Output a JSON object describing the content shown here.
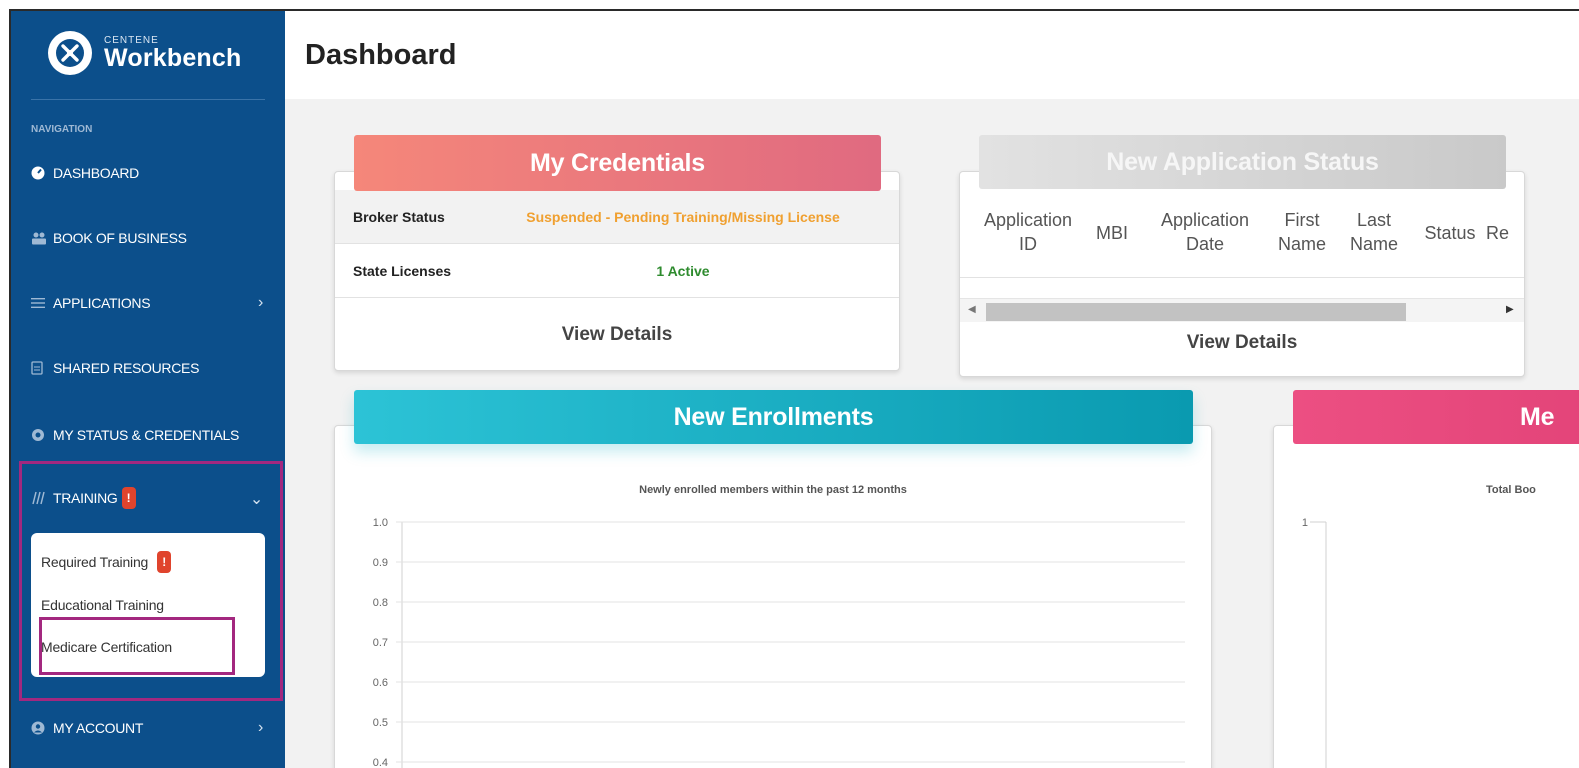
{
  "app": {
    "brand_small": "CENTENE",
    "brand_big": "Workbench"
  },
  "sidebar": {
    "heading": "NAVIGATION",
    "items": [
      {
        "label": "DASHBOARD",
        "icon": "dashboard-gauge-icon"
      },
      {
        "label": "BOOK OF BUSINESS",
        "icon": "people-icon"
      },
      {
        "label": "APPLICATIONS",
        "icon": "list-icon",
        "has_chevron": true
      },
      {
        "label": "SHARED RESOURCES",
        "icon": "document-icon"
      },
      {
        "label": "MY STATUS & CREDENTIALS",
        "icon": "gear-badge-icon"
      },
      {
        "label": "TRAINING",
        "icon": "books-icon",
        "badge": "!",
        "expanded": true
      },
      {
        "label": "MY ACCOUNT",
        "icon": "user-circle-icon",
        "has_chevron": true
      }
    ],
    "training_submenu": [
      {
        "label": "Required Training",
        "badge": "!"
      },
      {
        "label": "Educational Training"
      },
      {
        "label": "Medicare Certification",
        "highlighted": true
      }
    ],
    "chevron_right": "›",
    "chevron_down": "⌄"
  },
  "header": {
    "title": "Dashboard"
  },
  "credentials_card": {
    "title": "My Credentials",
    "rows": [
      {
        "label": "Broker Status",
        "value": "Suspended - Pending Training/Missing License",
        "color": "#f0a030"
      },
      {
        "label": "State Licenses",
        "value": "1 Active",
        "color": "#2e8b2e"
      }
    ],
    "view_details": "View Details"
  },
  "application_status_card": {
    "title": "New Application Status",
    "columns": [
      [
        "Application",
        "ID"
      ],
      [
        "MBI"
      ],
      [
        "Application",
        "Date"
      ],
      [
        "First",
        "Name"
      ],
      [
        "Last",
        "Name"
      ],
      [
        "Status"
      ],
      [
        "Re"
      ]
    ],
    "view_details": "View Details"
  },
  "enrollments_card": {
    "title": "New Enrollments"
  },
  "members_card": {
    "title": "Me"
  },
  "colors": {
    "sidebar_bg": "#0c4f8b",
    "highlight_border": "#a3287f",
    "credentials_header": "#f0837a",
    "status_header": "#cfcfcf",
    "enrollments_header": "#22bcd0",
    "members_header": "#e64a7c",
    "alert_badge": "#e0442d"
  },
  "chart_data": [
    {
      "type": "line",
      "title": "Newly enrolled members within the past 12 months",
      "y_ticks": [
        "1.0",
        "0.9",
        "0.8",
        "0.7",
        "0.6",
        "0.5",
        "0.4"
      ],
      "ylim": [
        0.4,
        1.0
      ],
      "series": [],
      "grid": true
    },
    {
      "type": "line",
      "title": "Total Boo",
      "y_ticks": [
        "1"
      ],
      "series": [],
      "grid": false
    }
  ]
}
